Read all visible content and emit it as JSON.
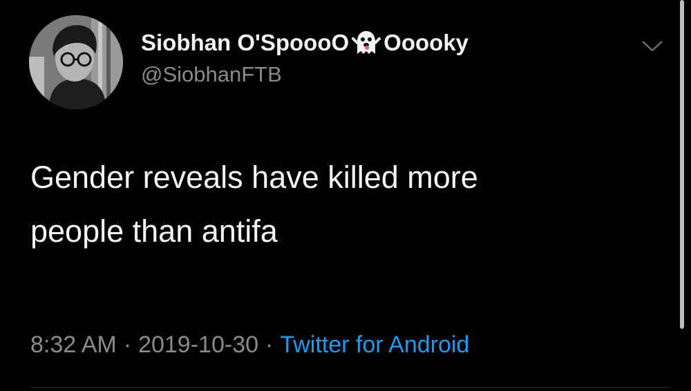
{
  "tweet": {
    "author": {
      "name_part1": "Siobhan O'SpoooO",
      "name_emoji_icon": "ghost-emoji-icon",
      "name_part2": "Ooooky",
      "handle": "@SiobhanFTB"
    },
    "text_line1": "Gender reveals have killed more",
    "text_line2": "people than antifa",
    "time": "8:32 AM",
    "date": "2019-10-30",
    "separator": "·",
    "source": "Twitter for Android"
  },
  "colors": {
    "background": "#000000",
    "name_text": "#f2f2f2",
    "muted_text": "#8b8b8b",
    "link_blue": "#1d9bf0"
  }
}
